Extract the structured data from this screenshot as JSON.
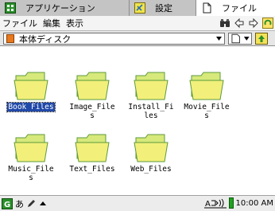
{
  "tabs": [
    {
      "label": "アプリケーション",
      "icon": "grid-icon"
    },
    {
      "label": "設定",
      "icon": "settings-icon"
    },
    {
      "label": "ファイル",
      "icon": "file-icon"
    }
  ],
  "menu": {
    "items": [
      "ファイル",
      "編集",
      "表示"
    ]
  },
  "toolbar": {
    "icons": [
      "binoculars-icon",
      "back-arrow-icon",
      "forward-arrow-icon",
      "refresh-icon"
    ]
  },
  "address": {
    "current_location": "本体ディスク"
  },
  "files": [
    {
      "name": "Book Files",
      "selected": true
    },
    {
      "name": "Image_Files",
      "selected": false
    },
    {
      "name": "Install_Files",
      "selected": false
    },
    {
      "name": "Movie_Files",
      "selected": false
    },
    {
      "name": "Music_Files",
      "selected": false
    },
    {
      "name": "Text_Files",
      "selected": false
    },
    {
      "name": "Web_Files",
      "selected": false
    }
  ],
  "status": {
    "ime": "あ",
    "clock": "10:00 AM"
  },
  "colors": {
    "selection": "#2149a8",
    "folder_fill": "#f2f07a",
    "folder_edge": "#5d9a3c",
    "battery": "#1ea31e"
  }
}
